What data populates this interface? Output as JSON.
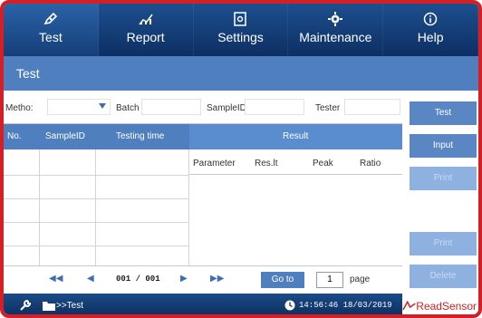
{
  "nav": [
    {
      "label": "Test",
      "icon": "pen-icon",
      "active": true
    },
    {
      "label": "Report",
      "icon": "chart-icon",
      "active": false
    },
    {
      "label": "Settings",
      "icon": "settings-icon",
      "active": false
    },
    {
      "label": "Maintenance",
      "icon": "gear-icon",
      "active": false
    },
    {
      "label": "Help",
      "icon": "info-icon",
      "active": false
    }
  ],
  "title": "Test",
  "filters": {
    "method_label": "Metho:",
    "batch_label": "Batch",
    "sampleid_label": "SampleID",
    "tester_label": "Tester"
  },
  "table": {
    "headers": [
      "No.",
      "SampleID",
      "Testing time",
      "Result"
    ],
    "result_subheaders": [
      "Parameter",
      "Res.lt",
      "Peak",
      "Ratio"
    ]
  },
  "pager": {
    "first": "◀◀",
    "prev": "◀",
    "page_info": "001 / 001",
    "next": "▶",
    "last": "▶▶",
    "goto_label": "Go to",
    "page_value": "1",
    "page_label": "page"
  },
  "side_buttons": [
    "Test",
    "Input",
    "Print",
    "Print",
    "Delete"
  ],
  "status": {
    "breadcrumb": ">>Test",
    "datetime": "14:56:46 18/03/2019"
  },
  "brand": "ReadSensor",
  "colors": {
    "nav_bg": "#0d2f63",
    "title_bg": "#4f7fbe",
    "button_bg": "#5a86c3",
    "frame_border": "#d41f26"
  }
}
